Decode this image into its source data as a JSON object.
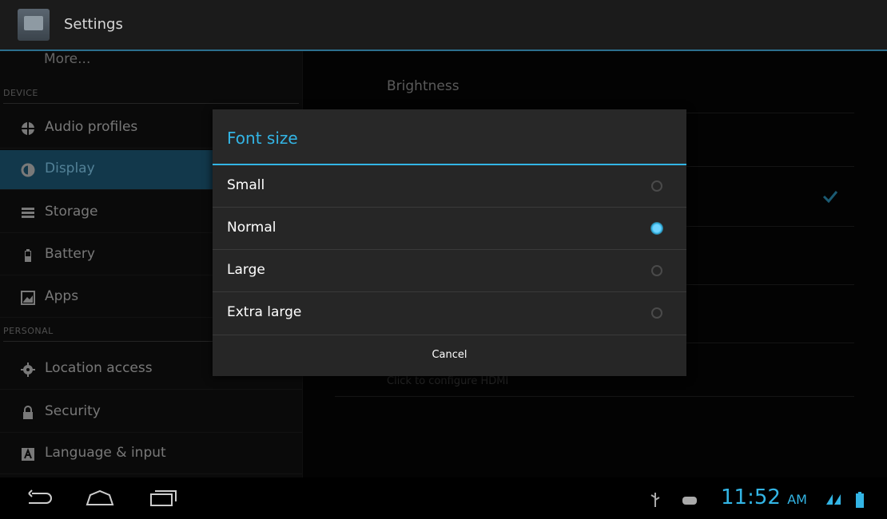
{
  "actionbar": {
    "title": "Settings",
    "icon": "settings-app-icon"
  },
  "sidebar": {
    "more_label": "More...",
    "device_header": "DEVICE",
    "personal_header": "PERSONAL",
    "items": [
      {
        "label": "Audio profiles",
        "icon": "audio-profiles-icon"
      },
      {
        "label": "Display",
        "icon": "display-icon",
        "selected": true
      },
      {
        "label": "Storage",
        "icon": "storage-icon"
      },
      {
        "label": "Battery",
        "icon": "battery-icon"
      },
      {
        "label": "Apps",
        "icon": "apps-icon"
      },
      {
        "label": "Location access",
        "icon": "location-icon"
      },
      {
        "label": "Security",
        "icon": "lock-icon"
      },
      {
        "label": "Language & input",
        "icon": "language-icon"
      }
    ]
  },
  "main": {
    "brightness_title": "Brightness",
    "faded_summary": "Click to configure HDMI"
  },
  "dialog": {
    "title": "Font size",
    "options": [
      {
        "label": "Small",
        "selected": false
      },
      {
        "label": "Normal",
        "selected": true
      },
      {
        "label": "Large",
        "selected": false
      },
      {
        "label": "Extra large",
        "selected": false
      }
    ],
    "cancel_label": "Cancel"
  },
  "statusbar": {
    "time": "11:52",
    "ampm": "AM"
  },
  "colors": {
    "accent": "#33b5e5",
    "selected_bg": "#1d5674"
  }
}
